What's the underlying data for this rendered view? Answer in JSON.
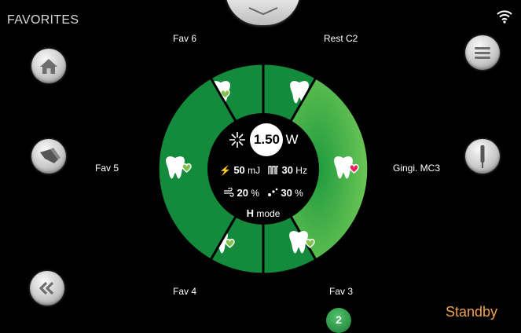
{
  "header": {
    "title": "FAVORITES"
  },
  "dial": {
    "power_value": "1.50",
    "power_unit": "W",
    "energy_value": "50",
    "energy_unit": "mJ",
    "freq_value": "30",
    "freq_unit": "Hz",
    "air_value": "20",
    "air_unit": "%",
    "water_value": "30",
    "water_unit": "%",
    "mode_letter": "H",
    "mode_word": "mode"
  },
  "favorites": [
    {
      "label": "Fav 6",
      "heart_color": "#7ec24a"
    },
    {
      "label": "Rest C2",
      "heart_color": "#1e6fc8"
    },
    {
      "label": "Gingi. MC3",
      "heart_color": "#e8245c",
      "selected": true
    },
    {
      "label": "Fav 3",
      "heart_color": "#7ec24a"
    },
    {
      "label": "Fav 4",
      "heart_color": "#7ec24a"
    },
    {
      "label": "Fav 5",
      "heart_color": "#7ec24a"
    }
  ],
  "status": {
    "text": "Standby",
    "page_badge": "2"
  },
  "icons": {
    "left": [
      "home-icon",
      "handpiece-icon",
      "double-chevron-left-icon"
    ],
    "right": [
      "menu-icon",
      "tip-icon"
    ],
    "top": "chevron-down-icon",
    "status": "wifi-icon"
  },
  "colors": {
    "segment": "#148a3c",
    "segment_selected": "#55c24a",
    "standby": "#f0a24a"
  }
}
